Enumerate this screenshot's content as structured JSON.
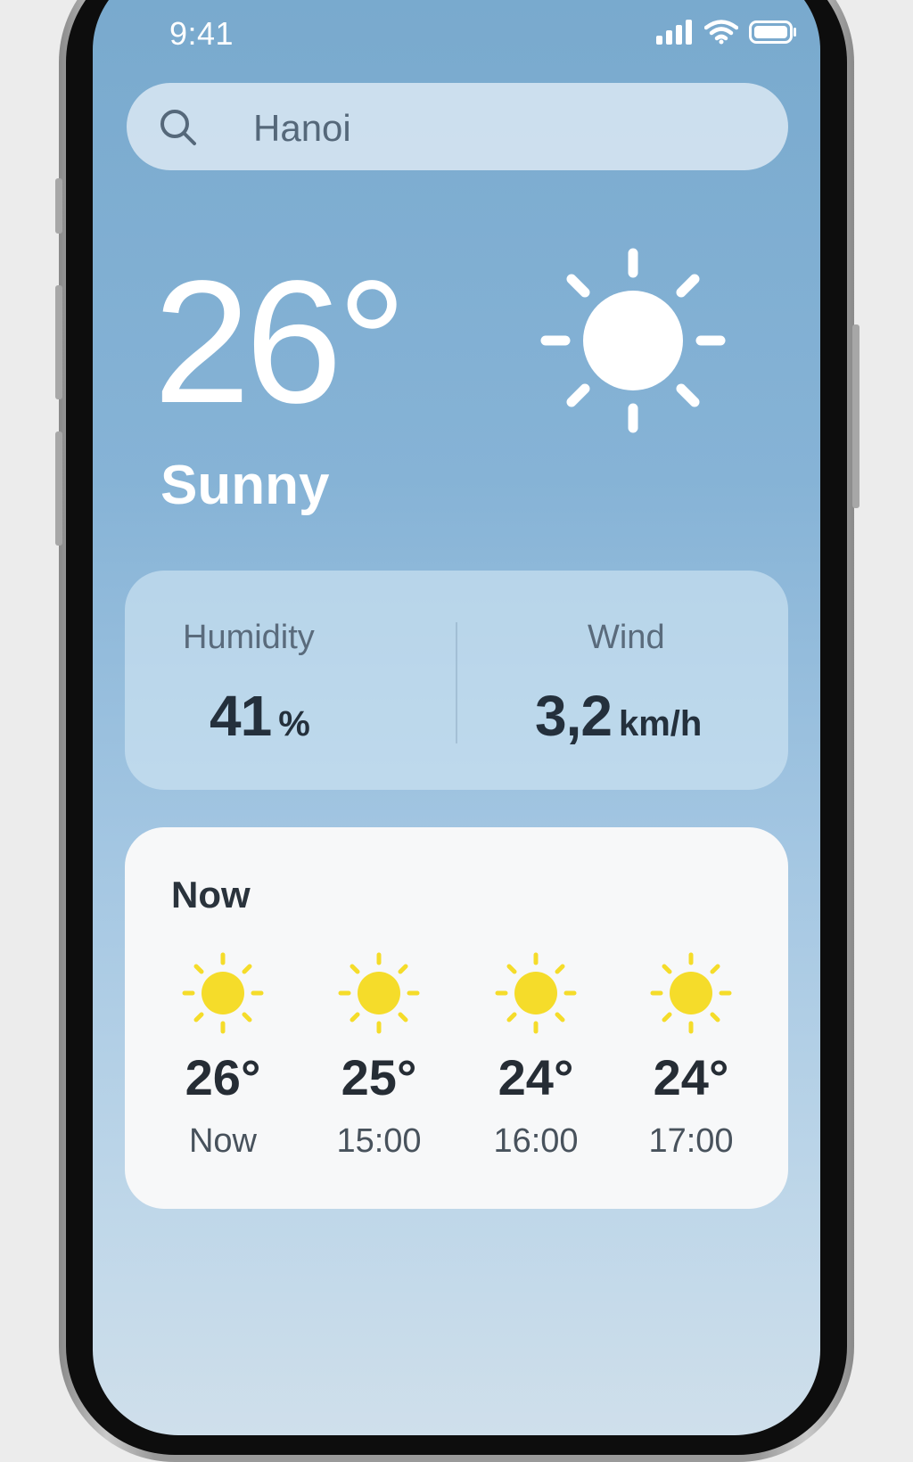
{
  "status_bar": {
    "time": "9:41"
  },
  "search": {
    "query": "Hanoi"
  },
  "current": {
    "temperature": "26°",
    "condition": "Sunny",
    "icon": "sun-icon"
  },
  "stats": {
    "humidity": {
      "label": "Humidity",
      "value": "41",
      "unit": "%"
    },
    "wind": {
      "label": "Wind",
      "value": "3,2",
      "unit": "km/h"
    }
  },
  "forecast": {
    "title": "Now",
    "hours": [
      {
        "temp": "26°",
        "time": "Now",
        "icon": "sun-icon"
      },
      {
        "temp": "25°",
        "time": "15:00",
        "icon": "sun-icon"
      },
      {
        "temp": "24°",
        "time": "16:00",
        "icon": "sun-icon"
      },
      {
        "temp": "24°",
        "time": "17:00",
        "icon": "sun-icon"
      }
    ]
  },
  "colors": {
    "sun_yellow": "#f5dc2a",
    "text_dark": "#24303c",
    "sky_top": "#78a9cd",
    "sky_bottom": "#cfdfeb"
  }
}
